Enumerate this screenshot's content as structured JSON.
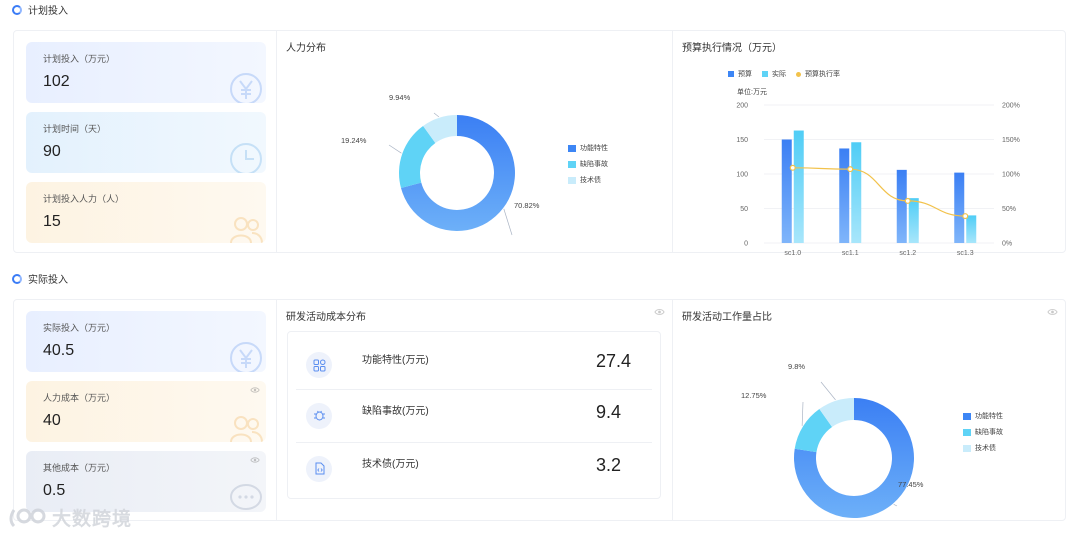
{
  "planned_section": {
    "title": "计划投入",
    "cards": [
      {
        "label": "计划投入（万元）",
        "value": "102",
        "icon": "yen-icon"
      },
      {
        "label": "计划时间（天）",
        "value": "90",
        "icon": "clock-icon"
      },
      {
        "label": "计划投入人力（人）",
        "value": "15",
        "icon": "people-icon"
      }
    ],
    "manpower": {
      "title": "人力分布",
      "legend": [
        "功能特性",
        "缺陷事故",
        "技术债"
      ],
      "percent_labels": [
        "70.82%",
        "19.24%",
        "9.94%"
      ]
    },
    "budget": {
      "title": "预算执行情况（万元）",
      "unit_label": "单位:万元",
      "legend": [
        "预算",
        "实际",
        "预算执行率"
      ]
    }
  },
  "actual_section": {
    "title": "实际投入",
    "cards": [
      {
        "label": "实际投入（万元）",
        "value": "40.5",
        "icon": "yen-icon"
      },
      {
        "label": "人力成本（万元）",
        "value": "40",
        "icon": "people-icon"
      },
      {
        "label": "其他成本（万元）",
        "value": "0.5",
        "icon": "chat-icon"
      }
    ],
    "cost_distribution": {
      "title": "研发活动成本分布",
      "rows": [
        {
          "label": "功能特性(万元)",
          "value": "27.4",
          "icon": "grid-icon"
        },
        {
          "label": "缺陷事故(万元)",
          "value": "9.4",
          "icon": "bug-icon"
        },
        {
          "label": "技术债(万元)",
          "value": "3.2",
          "icon": "code-file-icon"
        }
      ]
    },
    "workload": {
      "title": "研发活动工作量占比",
      "legend": [
        "功能特性",
        "缺陷事故",
        "技术债"
      ],
      "percent_labels": [
        "77.45%",
        "12.75%",
        "9.8%"
      ]
    }
  },
  "watermark": "大数跨境",
  "colors": {
    "series1": "#3d86f5",
    "series2": "#5fd3f6",
    "series3": "#c9ecfb",
    "line": "#f2c24b"
  },
  "chart_data": [
    {
      "type": "pie",
      "donut": true,
      "labels": [
        "功能特性",
        "缺陷事故",
        "技术债"
      ],
      "values": [
        70.82,
        19.24,
        9.94
      ]
    },
    {
      "type": "bar",
      "categories": [
        "sc1.0",
        "sc1.1",
        "sc1.2",
        "sc1.3"
      ],
      "series": [
        {
          "name": "预算",
          "values": [
            150,
            137,
            106,
            102
          ],
          "axis": "left"
        },
        {
          "name": "实际",
          "values": [
            163,
            146,
            65,
            40
          ],
          "axis": "left"
        },
        {
          "name": "预算执行率",
          "values": [
            109,
            107,
            61,
            39
          ],
          "axis": "right",
          "render": "line"
        }
      ],
      "ylim": [
        0,
        200
      ],
      "yticks": [
        0,
        50,
        100,
        150,
        200
      ],
      "y2lim": [
        0,
        200
      ],
      "y2ticks": [
        "0%",
        "50%",
        "100%",
        "150%",
        "200%"
      ],
      "grid": true,
      "legend": "top-left"
    },
    {
      "type": "pie",
      "donut": true,
      "labels": [
        "功能特性",
        "缺陷事故",
        "技术债"
      ],
      "values": [
        77.45,
        12.75,
        9.8
      ]
    }
  ]
}
